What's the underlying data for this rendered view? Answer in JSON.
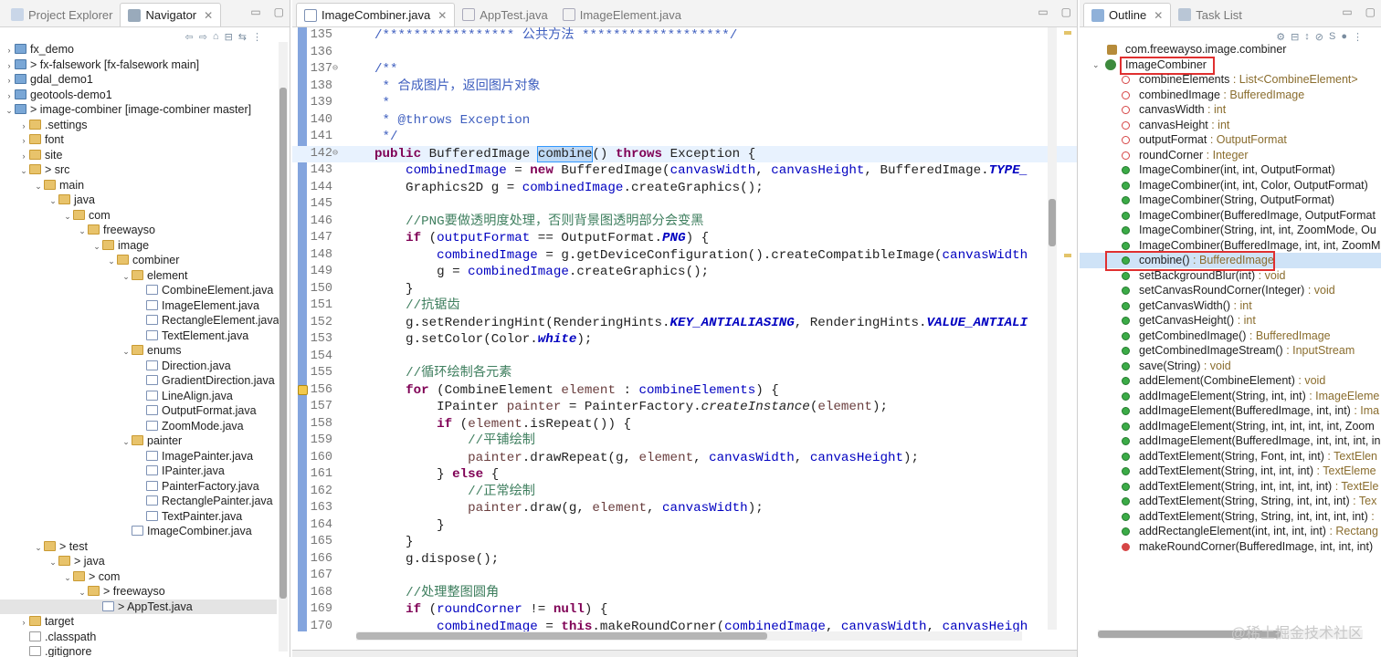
{
  "left_panel": {
    "tabs": [
      {
        "label": "Project Explorer"
      },
      {
        "label": "Navigator"
      }
    ],
    "tree": [
      {
        "label": "fx_demo",
        "depth": 0,
        "kind": "project",
        "arrow": "›"
      },
      {
        "label": "> fx-falsework [fx-falsework main]",
        "depth": 0,
        "kind": "project",
        "arrow": "›"
      },
      {
        "label": "gdal_demo1",
        "depth": 0,
        "kind": "project",
        "arrow": "›"
      },
      {
        "label": "geotools-demo1",
        "depth": 0,
        "kind": "project",
        "arrow": "›"
      },
      {
        "label": "> image-combiner [image-combiner master]",
        "depth": 0,
        "kind": "project",
        "arrow": "⌄"
      },
      {
        "label": ".settings",
        "depth": 1,
        "kind": "folder",
        "arrow": "›"
      },
      {
        "label": "font",
        "depth": 1,
        "kind": "folder",
        "arrow": "›"
      },
      {
        "label": "site",
        "depth": 1,
        "kind": "folder",
        "arrow": "›"
      },
      {
        "label": "> src",
        "depth": 1,
        "kind": "folder",
        "arrow": "⌄"
      },
      {
        "label": "main",
        "depth": 2,
        "kind": "folder",
        "arrow": "⌄"
      },
      {
        "label": "java",
        "depth": 3,
        "kind": "folder",
        "arrow": "⌄"
      },
      {
        "label": "com",
        "depth": 4,
        "kind": "folder",
        "arrow": "⌄"
      },
      {
        "label": "freewayso",
        "depth": 5,
        "kind": "folder",
        "arrow": "⌄"
      },
      {
        "label": "image",
        "depth": 6,
        "kind": "folder",
        "arrow": "⌄"
      },
      {
        "label": "combiner",
        "depth": 7,
        "kind": "folder",
        "arrow": "⌄"
      },
      {
        "label": "element",
        "depth": 8,
        "kind": "folder",
        "arrow": "⌄"
      },
      {
        "label": "CombineElement.java",
        "depth": 9,
        "kind": "jfile",
        "arrow": ""
      },
      {
        "label": "ImageElement.java",
        "depth": 9,
        "kind": "jfile",
        "arrow": ""
      },
      {
        "label": "RectangleElement.java",
        "depth": 9,
        "kind": "jfile",
        "arrow": ""
      },
      {
        "label": "TextElement.java",
        "depth": 9,
        "kind": "jfile",
        "arrow": ""
      },
      {
        "label": "enums",
        "depth": 8,
        "kind": "folder",
        "arrow": "⌄"
      },
      {
        "label": "Direction.java",
        "depth": 9,
        "kind": "jfile",
        "arrow": ""
      },
      {
        "label": "GradientDirection.java",
        "depth": 9,
        "kind": "jfile",
        "arrow": ""
      },
      {
        "label": "LineAlign.java",
        "depth": 9,
        "kind": "jfile",
        "arrow": ""
      },
      {
        "label": "OutputFormat.java",
        "depth": 9,
        "kind": "jfile",
        "arrow": ""
      },
      {
        "label": "ZoomMode.java",
        "depth": 9,
        "kind": "jfile",
        "arrow": ""
      },
      {
        "label": "painter",
        "depth": 8,
        "kind": "folder",
        "arrow": "⌄"
      },
      {
        "label": "ImagePainter.java",
        "depth": 9,
        "kind": "jfile",
        "arrow": ""
      },
      {
        "label": "IPainter.java",
        "depth": 9,
        "kind": "jfile",
        "arrow": ""
      },
      {
        "label": "PainterFactory.java",
        "depth": 9,
        "kind": "jfile",
        "arrow": ""
      },
      {
        "label": "RectanglePainter.java",
        "depth": 9,
        "kind": "jfile",
        "arrow": ""
      },
      {
        "label": "TextPainter.java",
        "depth": 9,
        "kind": "jfile",
        "arrow": ""
      },
      {
        "label": "ImageCombiner.java",
        "depth": 8,
        "kind": "jfile",
        "arrow": ""
      },
      {
        "label": "> test",
        "depth": 2,
        "kind": "folder",
        "arrow": "⌄"
      },
      {
        "label": "> java",
        "depth": 3,
        "kind": "folder",
        "arrow": "⌄"
      },
      {
        "label": "> com",
        "depth": 4,
        "kind": "folder",
        "arrow": "⌄"
      },
      {
        "label": "> freewayso",
        "depth": 5,
        "kind": "folder",
        "arrow": "⌄"
      },
      {
        "label": "> AppTest.java",
        "depth": 6,
        "kind": "jfile",
        "arrow": "",
        "selected": true
      },
      {
        "label": "target",
        "depth": 1,
        "kind": "folder",
        "arrow": "›"
      },
      {
        "label": ".classpath",
        "depth": 1,
        "kind": "xfile",
        "arrow": ""
      },
      {
        "label": ".gitignore",
        "depth": 1,
        "kind": "xfile",
        "arrow": ""
      }
    ]
  },
  "editor": {
    "tabs": [
      {
        "label": "ImageCombiner.java"
      },
      {
        "label": "AppTest.java"
      },
      {
        "label": "ImageElement.java"
      }
    ],
    "lines": [
      {
        "n": "135",
        "html": "<span class=\"dc\">/***************** 公共方法 *******************/</span>"
      },
      {
        "n": "136",
        "html": ""
      },
      {
        "n": "137",
        "fold": true,
        "html": "<span class=\"dc\">/**</span>"
      },
      {
        "n": "138",
        "html": "<span class=\"dc\"> * 合成图片，返回图片对象</span>"
      },
      {
        "n": "139",
        "html": "<span class=\"dc\"> *</span>"
      },
      {
        "n": "140",
        "html": "<span class=\"dc\"> * @throws Exception</span>"
      },
      {
        "n": "141",
        "html": "<span class=\"dc\"> */</span>"
      },
      {
        "n": "142",
        "fold": true,
        "current": true,
        "html": "<span class=\"kw\">public</span> BufferedImage <span class=\"hl\">combine</span>() <span class=\"kw\">throws</span> Exception {"
      },
      {
        "n": "143",
        "html": "    <span class=\"fld\">combinedImage</span> = <span class=\"kw\">new</span> BufferedImage(<span class=\"fld\">canvasWidth</span>, <span class=\"fld\">canvasHeight</span>, BufferedImage.<span class=\"sfi\">TYPE_</span>"
      },
      {
        "n": "144",
        "html": "    Graphics2D g = <span class=\"fld\">combinedImage</span>.createGraphics();"
      },
      {
        "n": "145",
        "html": ""
      },
      {
        "n": "146",
        "html": "    <span class=\"cm\">//PNG要做透明度处理，否则背景图透明部分会变黑</span>"
      },
      {
        "n": "147",
        "html": "    <span class=\"kw\">if</span> (<span class=\"fld\">outputFormat</span> == OutputFormat.<span class=\"sfi\">PNG</span>) {"
      },
      {
        "n": "148",
        "html": "        <span class=\"fld\">combinedImage</span> = g.getDeviceConfiguration().createCompatibleImage(<span class=\"fld\">canvasWidth</span>"
      },
      {
        "n": "149",
        "html": "        g = <span class=\"fld\">combinedImage</span>.createGraphics();"
      },
      {
        "n": "150",
        "html": "    }"
      },
      {
        "n": "151",
        "html": "    <span class=\"cm\">//抗锯齿</span>"
      },
      {
        "n": "152",
        "html": "    g.setRenderingHint(RenderingHints.<span class=\"sfi\">KEY_ANTIALIASING</span>, RenderingHints.<span class=\"sfi\">VALUE_ANTIALI</span>"
      },
      {
        "n": "153",
        "html": "    g.setColor(Color.<span class=\"sfi\">white</span>);"
      },
      {
        "n": "154",
        "html": ""
      },
      {
        "n": "155",
        "html": "    <span class=\"cm\">//循环绘制各元素</span>"
      },
      {
        "n": "156",
        "marker": true,
        "html": "    <span class=\"kw\">for</span> (CombineElement <span style=\"color:#6a3e3e\">element</span> : <span class=\"fld\">combineElements</span>) {"
      },
      {
        "n": "157",
        "html": "        IPainter <span style=\"color:#6a3e3e\">painter</span> = PainterFactory.<span class=\"itl\">createInstance</span>(<span style=\"color:#6a3e3e\">element</span>);"
      },
      {
        "n": "158",
        "html": "        <span class=\"kw\">if</span> (<span style=\"color:#6a3e3e\">element</span>.isRepeat()) {"
      },
      {
        "n": "159",
        "html": "            <span class=\"cm\">//平铺绘制</span>"
      },
      {
        "n": "160",
        "html": "            <span style=\"color:#6a3e3e\">painter</span>.drawRepeat(g, <span style=\"color:#6a3e3e\">element</span>, <span class=\"fld\">canvasWidth</span>, <span class=\"fld\">canvasHeight</span>);"
      },
      {
        "n": "161",
        "html": "        } <span class=\"kw\">else</span> {"
      },
      {
        "n": "162",
        "html": "            <span class=\"cm\">//正常绘制</span>"
      },
      {
        "n": "163",
        "html": "            <span style=\"color:#6a3e3e\">painter</span>.draw(g, <span style=\"color:#6a3e3e\">element</span>, <span class=\"fld\">canvasWidth</span>);"
      },
      {
        "n": "164",
        "html": "        }"
      },
      {
        "n": "165",
        "html": "    }"
      },
      {
        "n": "166",
        "html": "    g.dispose();"
      },
      {
        "n": "167",
        "html": ""
      },
      {
        "n": "168",
        "html": "    <span class=\"cm\">//处理整图圆角</span>"
      },
      {
        "n": "169",
        "html": "    <span class=\"kw\">if</span> (<span class=\"fld\">roundCorner</span> != <span class=\"kw\">null</span>) {"
      },
      {
        "n": "170",
        "html": "        <span class=\"fld\">combinedImage</span> = <span class=\"kw\">this</span>.makeRoundCorner(<span class=\"fld\">combinedImage</span>, <span class=\"fld\">canvasWidth</span>, <span class=\"fld\">canvasHeigh</span>"
      }
    ]
  },
  "right_panel": {
    "tabs": [
      {
        "label": "Outline"
      },
      {
        "label": "Task List"
      }
    ],
    "package": "com.freewayso.image.combiner",
    "class_name": "ImageCombiner",
    "members": [
      {
        "name": "combineElements",
        "type": " : List<CombineElement>",
        "vis": "pri"
      },
      {
        "name": "combinedImage",
        "type": " : BufferedImage",
        "vis": "pri"
      },
      {
        "name": "canvasWidth",
        "type": " : int",
        "vis": "pri"
      },
      {
        "name": "canvasHeight",
        "type": " : int",
        "vis": "pri"
      },
      {
        "name": "outputFormat",
        "type": " : OutputFormat",
        "vis": "pri"
      },
      {
        "name": "roundCorner",
        "type": " : Integer",
        "vis": "pri"
      },
      {
        "name": "ImageCombiner(int, int, OutputFormat)",
        "type": "",
        "vis": "pub"
      },
      {
        "name": "ImageCombiner(int, int, Color, OutputFormat)",
        "type": "",
        "vis": "pub"
      },
      {
        "name": "ImageCombiner(String, OutputFormat)",
        "type": "",
        "vis": "pub"
      },
      {
        "name": "ImageCombiner(BufferedImage, OutputFormat",
        "type": "",
        "vis": "pub"
      },
      {
        "name": "ImageCombiner(String, int, int, ZoomMode, Ou",
        "type": "",
        "vis": "pub"
      },
      {
        "name": "ImageCombiner(BufferedImage, int, int, ZoomM",
        "type": "",
        "vis": "pub"
      },
      {
        "name": "combine()",
        "type": " : BufferedImage",
        "vis": "pub",
        "highlight": true
      },
      {
        "name": "setBackgroundBlur(int)",
        "type": " : void",
        "vis": "pub"
      },
      {
        "name": "setCanvasRoundCorner(Integer)",
        "type": " : void",
        "vis": "pub"
      },
      {
        "name": "getCanvasWidth()",
        "type": " : int",
        "vis": "pub"
      },
      {
        "name": "getCanvasHeight()",
        "type": " : int",
        "vis": "pub"
      },
      {
        "name": "getCombinedImage()",
        "type": " : BufferedImage",
        "vis": "pub"
      },
      {
        "name": "getCombinedImageStream()",
        "type": " : InputStream",
        "vis": "pub"
      },
      {
        "name": "save(String)",
        "type": " : void",
        "vis": "pub"
      },
      {
        "name": "addElement(CombineElement)",
        "type": " : void",
        "vis": "pub"
      },
      {
        "name": "addImageElement(String, int, int)",
        "type": " : ImageEleme",
        "vis": "pub"
      },
      {
        "name": "addImageElement(BufferedImage, int, int)",
        "type": " : Ima",
        "vis": "pub"
      },
      {
        "name": "addImageElement(String, int, int, int, int, Zoom",
        "type": "",
        "vis": "pub"
      },
      {
        "name": "addImageElement(BufferedImage, int, int, int, in",
        "type": "",
        "vis": "pub"
      },
      {
        "name": "addTextElement(String, Font, int, int)",
        "type": " : TextElen",
        "vis": "pub"
      },
      {
        "name": "addTextElement(String, int, int, int)",
        "type": " : TextEleme",
        "vis": "pub"
      },
      {
        "name": "addTextElement(String, int, int, int, int)",
        "type": " : TextEle",
        "vis": "pub"
      },
      {
        "name": "addTextElement(String, String, int, int, int)",
        "type": " : Tex",
        "vis": "pub"
      },
      {
        "name": "addTextElement(String, String, int, int, int, int)",
        "type": " :",
        "vis": "pub"
      },
      {
        "name": "addRectangleElement(int, int, int, int)",
        "type": " : Rectang",
        "vis": "pub"
      },
      {
        "name": "makeRoundCorner(BufferedImage, int, int, int)",
        "type": "",
        "vis": "privsq"
      }
    ]
  },
  "watermark": "@稀土掘金技术社区",
  "colors": {
    "selection_box": "#e03030",
    "gutter_bar": "#6e95d8"
  }
}
